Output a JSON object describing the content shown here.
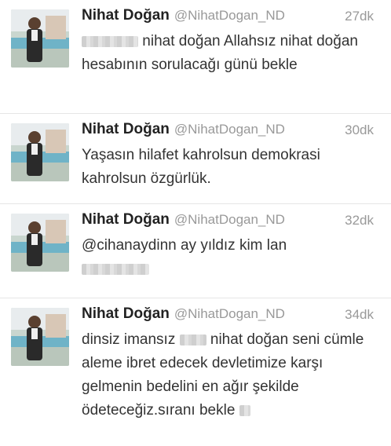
{
  "tweets": [
    {
      "name": "Nihat Doğan",
      "handle": "@NihatDogan_ND",
      "time": "27dk",
      "text_a": "nihat doğan Allahsız nihat doğan hesabının sorulacağı günü bekle"
    },
    {
      "name": "Nihat Doğan",
      "handle": "@NihatDogan_ND",
      "time": "30dk",
      "text_a": "Yaşasın hilafet  kahrolsun demokrasi kahrolsun özgürlük."
    },
    {
      "name": "Nihat Doğan",
      "handle": "@NihatDogan_ND",
      "time": "32dk",
      "text_a": "@cihanaydinn ay yıldız kim lan"
    },
    {
      "name": "Nihat Doğan",
      "handle": "@NihatDogan_ND",
      "time": "34dk",
      "text_a": "dinsiz imansız",
      "text_b": "nihat doğan seni cümle aleme ibret edecek devletimize karşı gelmenin bedelini en ağır şekilde ödeteceğiz.sıranı bekle"
    }
  ],
  "icons": {
    "avatar": "profile-photo-icon",
    "censor": "blurred-word"
  },
  "colors": {
    "muted": "#999999",
    "divider": "#e6e6e6",
    "text": "#333333"
  }
}
